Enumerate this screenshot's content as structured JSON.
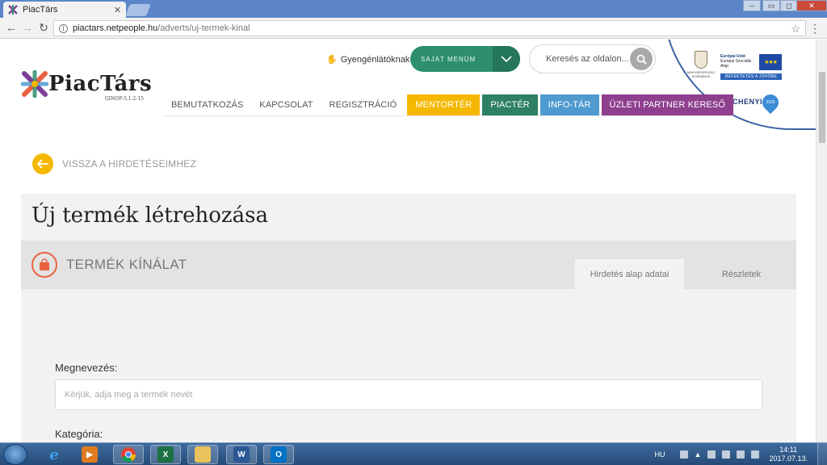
{
  "browser": {
    "tab_title": "PiacTárs",
    "url_host": "piactars.netpeople.hu",
    "url_path": "/adverts/uj-termek-kinal"
  },
  "header": {
    "logo_name": "PiacTárs",
    "logo_sub": "GINOP-5.1.2-15",
    "beginners_link": "Gyengénlátóknak",
    "my_menu_label": "SAJÁT MENÜM",
    "search_placeholder": "Keresés az oldalon...",
    "eu": {
      "gov_text": "MAGYARORSZÁG KORMÁNYA",
      "union_title": "Európai Unió",
      "union_sub": "Európai Szociális Alap",
      "slogan": "BEFEKTETÉS A JÖVŐBE",
      "program": "SZÉCHENYI",
      "year": "2020"
    }
  },
  "nav": {
    "items": [
      {
        "label": "BEMUTATKOZÁS",
        "color": ""
      },
      {
        "label": "KAPCSOLAT",
        "color": ""
      },
      {
        "label": "REGISZTRÁCIÓ",
        "color": ""
      },
      {
        "label": "MENTORTÉR",
        "color": "#f5b800"
      },
      {
        "label": "PIACTÉR",
        "color": "#2d7f65"
      },
      {
        "label": "INFO-TÁR",
        "color": "#4f9bd0"
      },
      {
        "label": "ÜZLETI PARTNER KERESŐ",
        "color": "#8e3f8e"
      }
    ]
  },
  "main": {
    "back_label": "VISSZA A HIRDETÉSEIMHEZ",
    "title": "Új termék létrehozása",
    "section_label": "TERMÉK KÍNÁLAT",
    "tabs": [
      {
        "label": "Hirdetés alap adatai",
        "active": true
      },
      {
        "label": "Részletek",
        "active": false
      }
    ],
    "fields": {
      "name_label": "Megnevezés:",
      "name_placeholder": "Kérjük, adja meg a termék nevét",
      "category_label": "Kategória:",
      "category_value": ""
    }
  },
  "taskbar": {
    "apps": [
      "internet-explorer",
      "media-player",
      "chrome",
      "excel",
      "file-explorer",
      "word",
      "outlook"
    ],
    "lang": "HU",
    "time": "14:11",
    "date": "2017.07.13."
  },
  "colors": {
    "accent_green": "#2d8f6f",
    "accent_yellow": "#f5b800",
    "accent_orange": "#e8623f"
  }
}
